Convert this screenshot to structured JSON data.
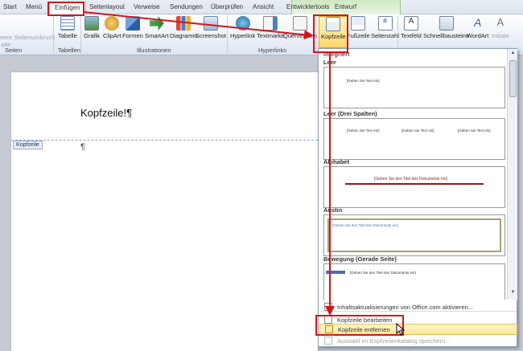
{
  "tabs": {
    "start": "Start",
    "menu": "Menü",
    "einfuegen": "Einfügen",
    "seitenlayout": "Seitenlayout",
    "verweise": "Verweise",
    "sendungen": "Sendungen",
    "ueberpruefen": "Überprüfen",
    "ansicht": "Ansicht",
    "entwicklertools": "Entwicklertools",
    "entwurf": "Entwurf"
  },
  "ribbon": {
    "seite_label": "eite",
    "seite_prefix": "eere",
    "seitenumbruch": "Seitenumbruch",
    "tabelle": "Tabelle",
    "grafik": "Grafik",
    "clipart": "ClipArt",
    "formen": "Formen",
    "smartart": "SmartArt",
    "diagramm": "Diagramm",
    "screenshot": "Screenshot",
    "hyperlink": "Hyperlink",
    "textmarke": "Textmarke",
    "querverweis": "Querverweis",
    "kopfzeile": "Kopfzeile",
    "fusszeile": "Fußzeile",
    "seitenzahl": "Seitenzahl",
    "textfeld": "Textfeld",
    "schnellbausteine": "Schnellbausteine",
    "wordart": "WordArt",
    "initiale": "Initiale",
    "groups": {
      "seiten": "Seiten",
      "tabellen": "Tabellen",
      "illustrationen": "Illustrationen",
      "hyperlinks": "Hyperlinks"
    }
  },
  "document": {
    "header_text": "Kopfzeile!¶",
    "header_tag": "Kopfzeile",
    "body_pilcrow": "¶"
  },
  "gallery": {
    "category": "Integriert",
    "sections": [
      {
        "title": "Leer",
        "placeholders": [
          "[Geben Sie Text ein]"
        ]
      },
      {
        "title": "Leer (Drei Spalten)",
        "placeholders": [
          "[Geben Sie Text ein]",
          "[Geben Sie Text ein]",
          "[Geben Sie Text ein]"
        ]
      },
      {
        "title": "Alphabet",
        "placeholders": [
          "[Geben Sie den Titel des Dokuments ein]"
        ]
      },
      {
        "title": "Austin",
        "placeholders": [
          "[Geben Sie den Titel des Dokuments ein]"
        ]
      },
      {
        "title": "Bewegung (Gerade Seite)",
        "placeholders": [
          "[Geben Sie den Titel des Dokuments ein]"
        ]
      }
    ],
    "menu": {
      "office_update": "Inhaltsaktualisierungen von Office.com aktivieren...",
      "edit": "Kopfzeile bearbeiten",
      "remove": "Kopfzeile entfernen",
      "save_selection": "Auswahl im Kopfzeilenkatalog speichern..."
    }
  },
  "colors": {
    "annotation": "#d6141a",
    "highlight": "#ffe79a",
    "alphabet_rule": "#8b1a1a",
    "bewegung_bar": "#4a6fb5"
  }
}
